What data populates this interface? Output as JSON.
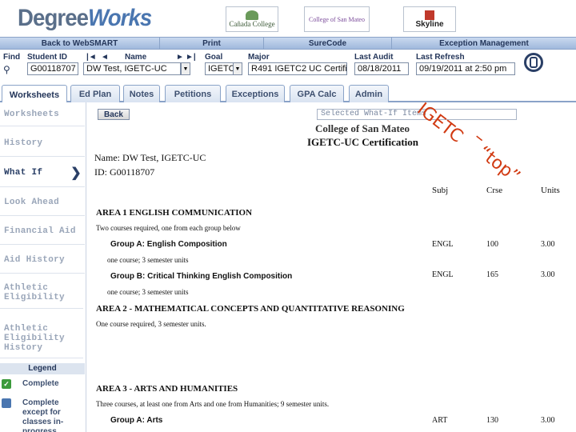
{
  "header": {
    "logo_main": "Degree",
    "logo_accent": "Works",
    "colleges": [
      "Cañada College",
      "College of San Mateo",
      "Skyline"
    ]
  },
  "navbar": [
    "Back to WebSMART",
    "Print",
    "SureCode",
    "Exception Management"
  ],
  "search": {
    "find_label": "Find",
    "student_id_label": "Student ID",
    "student_id": "G00118707",
    "name_label": "Name",
    "name": "DW Test, IGETC-UC",
    "goal_label": "Goal",
    "goal": "IGETC",
    "major_label": "Major",
    "major": "R491 IGETC2 UC Certific",
    "last_audit_label": "Last Audit",
    "last_audit": "08/18/2011",
    "last_refresh_label": "Last Refresh",
    "last_refresh": "09/19/2011 at 2:50 pm",
    "nav_first": "|◄",
    "nav_prev": "◄",
    "nav_next": "►",
    "nav_last": "►|"
  },
  "tabs": [
    "Worksheets",
    "Ed Plan",
    "Notes",
    "Petitions",
    "Exceptions",
    "GPA Calc",
    "Admin"
  ],
  "sidebar": {
    "items": [
      "Worksheets",
      "History",
      "What If",
      "Look Ahead",
      "Financial Aid",
      "Aid History",
      "Athletic Eligibility",
      "Athletic Eligibility History"
    ],
    "legend_title": "Legend",
    "legend": [
      {
        "label": "Complete",
        "icon": "check-icon"
      },
      {
        "label": "Complete except for classes in-progress",
        "icon": "partial-icon"
      }
    ]
  },
  "main": {
    "back_label": "Back",
    "select_value": "Selected What-If Items",
    "school_name": "College of San Mateo",
    "cert_title": "IGETC-UC Certification",
    "student_name": "Name:  DW Test, IGETC-UC",
    "student_id": "ID:  G00118707",
    "col_subj": "Subj",
    "col_crse": "Crse",
    "col_units": "Units",
    "area1_title": "AREA 1   ENGLISH COMMUNICATION",
    "area1_desc": "Two courses required, one from each group below",
    "groupA_title": "Group A: English Composition",
    "groupA_sub": "one course; 3 semester units",
    "groupA_subj": "ENGL",
    "groupA_crse": "100",
    "groupA_units": "3.00",
    "groupB_title": "Group B: Critical Thinking English Composition",
    "groupB_sub": "one course; 3 semester units",
    "groupB_subj": "ENGL",
    "groupB_crse": "165",
    "groupB_units": "3.00",
    "area2_title": "AREA 2 - MATHEMATICAL CONCEPTS AND QUANTITATIVE REASONING",
    "area2_desc": "One course required, 3 semester units.",
    "area3_title": "AREA 3 - ARTS AND HUMANITIES",
    "area3_desc": "Three courses, at least one from Arts and one from Humanities; 9 semester units.",
    "area3_groupA": "Group A: Arts",
    "area3_subj": "ART",
    "area3_crse": "130",
    "area3_units": "3.00"
  },
  "annotation": {
    "line1": "IGETC",
    "line2": "–",
    "line3": "“top”",
    "color": "#d13a12"
  }
}
